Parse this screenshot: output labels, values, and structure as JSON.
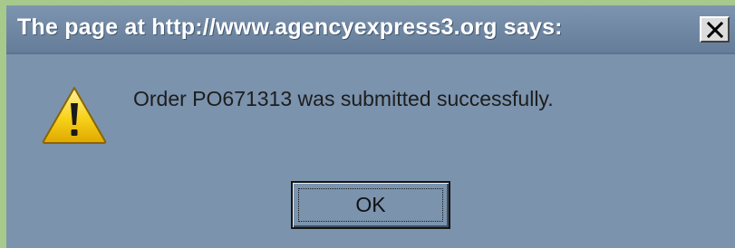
{
  "dialog": {
    "title": "The page at http://www.agencyexpress3.org says:",
    "message": "Order PO671313 was submitted successfully.",
    "ok_label": "OK",
    "icon": "warning-icon",
    "close_icon": "close-icon"
  },
  "colors": {
    "titlebar": "#6f87a2",
    "body": "#7b93ad",
    "outer_frame": "#86c06a",
    "warning_yellow": "#f7d21a"
  }
}
